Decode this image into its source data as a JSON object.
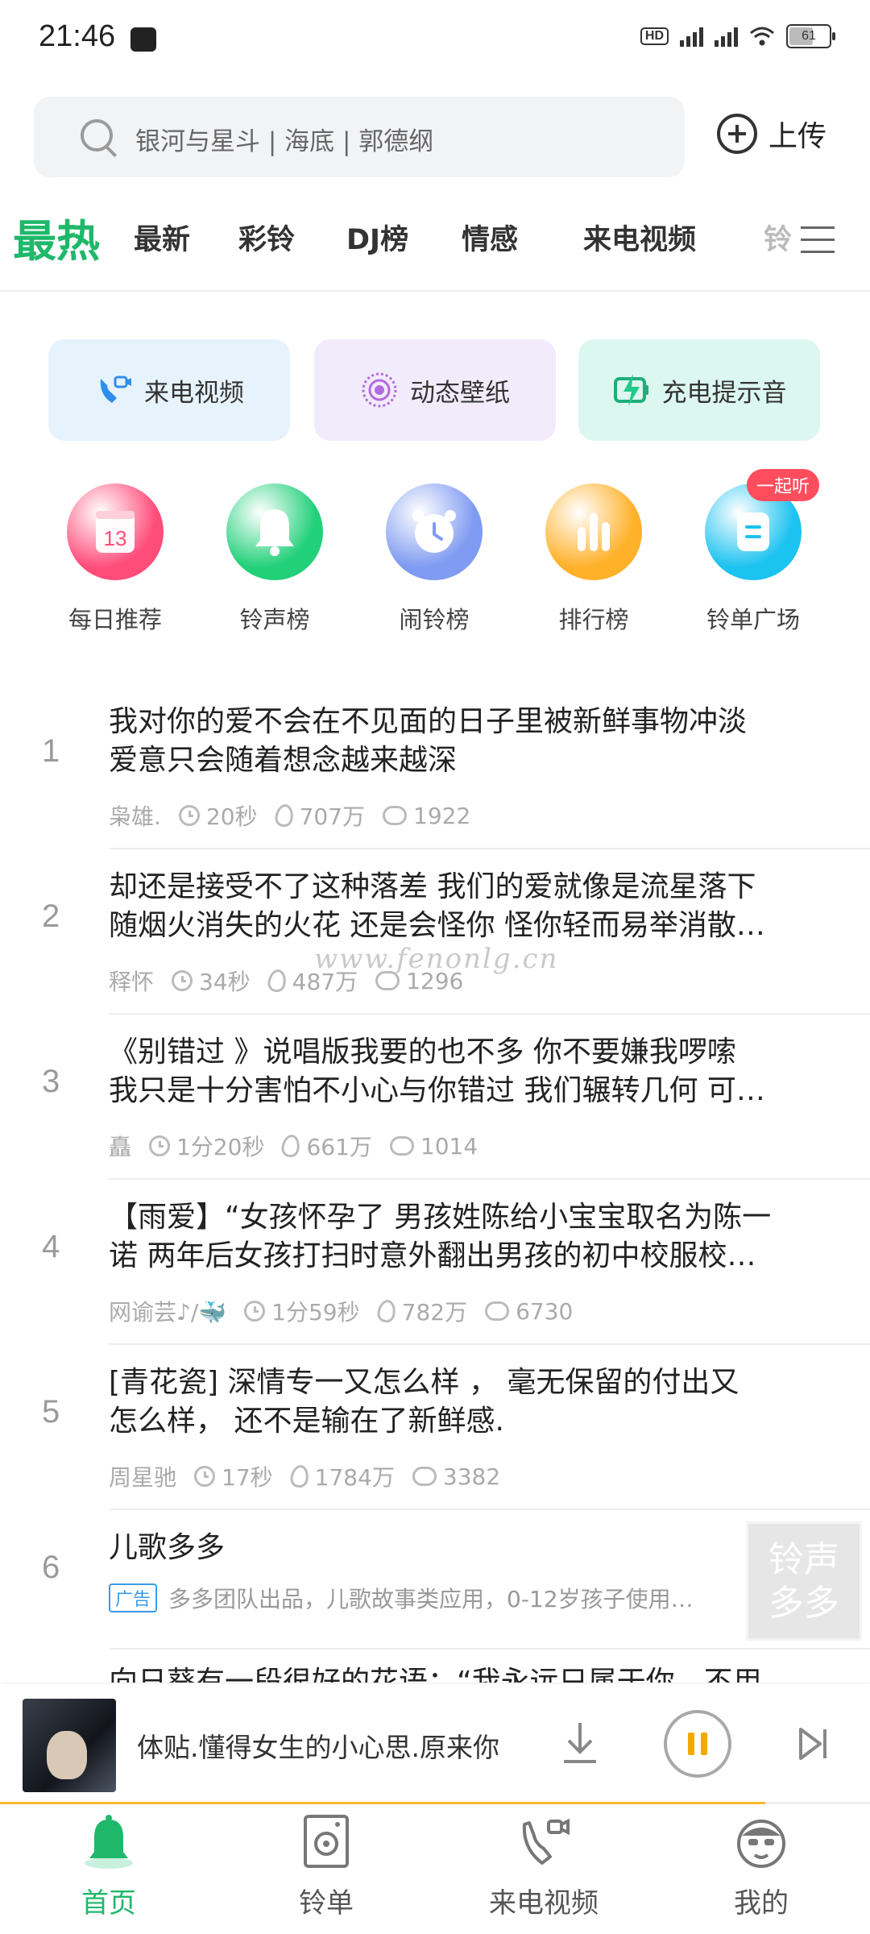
{
  "status_bar": {
    "time": "21:46",
    "battery": "61"
  },
  "search": {
    "placeholder": "银河与星斗 | 海底 | 郭德纲"
  },
  "header": {
    "upload_label": "上传"
  },
  "tabs": [
    {
      "label": "最热",
      "active": true
    },
    {
      "label": "最新"
    },
    {
      "label": "彩铃"
    },
    {
      "label": "DJ榜"
    },
    {
      "label": "情感"
    },
    {
      "label": "来电视频"
    },
    {
      "label": "铃"
    }
  ],
  "feature_cards": [
    {
      "label": "来电视频",
      "icon": "video-call-icon",
      "bg": "#e6f3fc"
    },
    {
      "label": "动态壁纸",
      "icon": "live-wallpaper-icon",
      "bg": "#f1ebfb"
    },
    {
      "label": "充电提示音",
      "icon": "charging-icon",
      "bg": "#dcf7ef"
    }
  ],
  "shortcuts": [
    {
      "label": "每日推荐",
      "icon": "calendar-icon",
      "date": "13",
      "color": "#ff4d7a"
    },
    {
      "label": "铃声榜",
      "icon": "bell-icon",
      "color": "#22d07a"
    },
    {
      "label": "闹铃榜",
      "icon": "alarm-clock-icon",
      "color": "#7f9bf2"
    },
    {
      "label": "排行榜",
      "icon": "bar-chart-icon",
      "color": "#ffb12a"
    },
    {
      "label": "铃单广场",
      "icon": "playlist-icon",
      "color": "#1cc2f0",
      "badge": "一起听"
    }
  ],
  "songs": [
    {
      "num": "1",
      "line1": "我对你的爱不会在不见面的日子里被新鲜事物冲淡",
      "line2": "爱意只会随着想念越来越深",
      "author": "枭雄.",
      "duration": "20秒",
      "plays": "707万",
      "comments": "1922"
    },
    {
      "num": "2",
      "line1": "却还是接受不了这种落差 我们的爱就像是流星落下",
      "line2": "随烟火消失的火花 还是会怪你 怪你轻而易举消散…",
      "author": "释怀",
      "duration": "34秒",
      "plays": "487万",
      "comments": "1296"
    },
    {
      "num": "3",
      "line1": "《别错过 》说唱版我要的也不多 你不要嫌我啰嗦",
      "line2": "我只是十分害怕不小心与你错过 我们辗转几何 可…",
      "author": "矗",
      "duration": "1分20秒",
      "plays": "661万",
      "comments": "1014"
    },
    {
      "num": "4",
      "line1": "【雨爱】“女孩怀孕了 男孩姓陈给小宝宝取名为陈一",
      "line2": "诺 两年后女孩打扫时意外翻出男孩的初中校服校…",
      "author": "网谕芸♪/🐳",
      "duration": "1分59秒",
      "plays": "782万",
      "comments": "6730"
    },
    {
      "num": "5",
      "line1": "[青花瓷]   深情专一又怎么样 ，  毫无保留的付出又",
      "line2": "怎么样，  还不是输在了新鲜感.",
      "author": "周星驰",
      "duration": "17秒",
      "plays": "1784万",
      "comments": "3382"
    }
  ],
  "ad_row": {
    "num": "6",
    "title": "儿歌多多",
    "tag": "广告",
    "text": "多多团队出品，儿歌故事类应用，0-12岁孩子使用…"
  },
  "partial_row_text": "向日葵有一段很好的花语：“我永远只属于你，不用",
  "watermark": "www.fenonlg.cn",
  "brand_stamp": [
    "铃声",
    "多多"
  ],
  "player": {
    "now_playing": "体贴.懂得女生的小心思.原来你",
    "progress": 0.88
  },
  "bottom_nav": [
    {
      "label": "首页",
      "icon": "home-bell-icon",
      "active": true
    },
    {
      "label": "铃单",
      "icon": "speaker-icon"
    },
    {
      "label": "来电视频",
      "icon": "phone-video-icon"
    },
    {
      "label": "我的",
      "icon": "profile-avatar-icon"
    }
  ],
  "colors": {
    "accent": "#1fb86a",
    "player_accent": "#f2a900"
  }
}
